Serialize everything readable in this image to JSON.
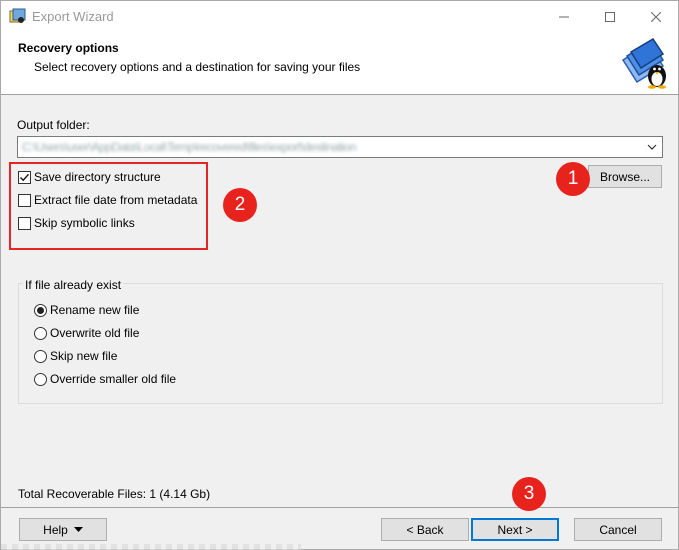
{
  "window": {
    "title": "Export Wizard",
    "controls": {
      "minimize": "minimize-icon",
      "maximize": "maximize-icon",
      "close": "close-icon"
    }
  },
  "header": {
    "title": "Recovery options",
    "subtitle": "Select recovery options and a destination for saving your files",
    "graphic": "folder-penguin-icon"
  },
  "output": {
    "label": "Output folder:",
    "value": "C:\\Users\\user\\AppData\\Local\\Temp\\recovered\\files\\export\\destination",
    "browse_label": "Browse..."
  },
  "options": [
    {
      "label": "Save directory structure",
      "checked": true
    },
    {
      "label": "Extract file date from metadata",
      "checked": false
    },
    {
      "label": "Skip symbolic links",
      "checked": false
    }
  ],
  "if_exist": {
    "title": "If file already exist",
    "choices": [
      {
        "label": "Rename new file",
        "selected": true
      },
      {
        "label": "Overwrite old file",
        "selected": false
      },
      {
        "label": "Skip new file",
        "selected": false
      },
      {
        "label": "Override smaller old file",
        "selected": false
      }
    ]
  },
  "total": "Total Recoverable Files: 1 (4.14 Gb)",
  "footer": {
    "help_label": "Help",
    "back_label": "< Back",
    "next_label": "Next >",
    "cancel_label": "Cancel"
  },
  "annotations": {
    "badge1": "1",
    "badge2": "2",
    "badge3": "3",
    "color": "#e8231d"
  }
}
